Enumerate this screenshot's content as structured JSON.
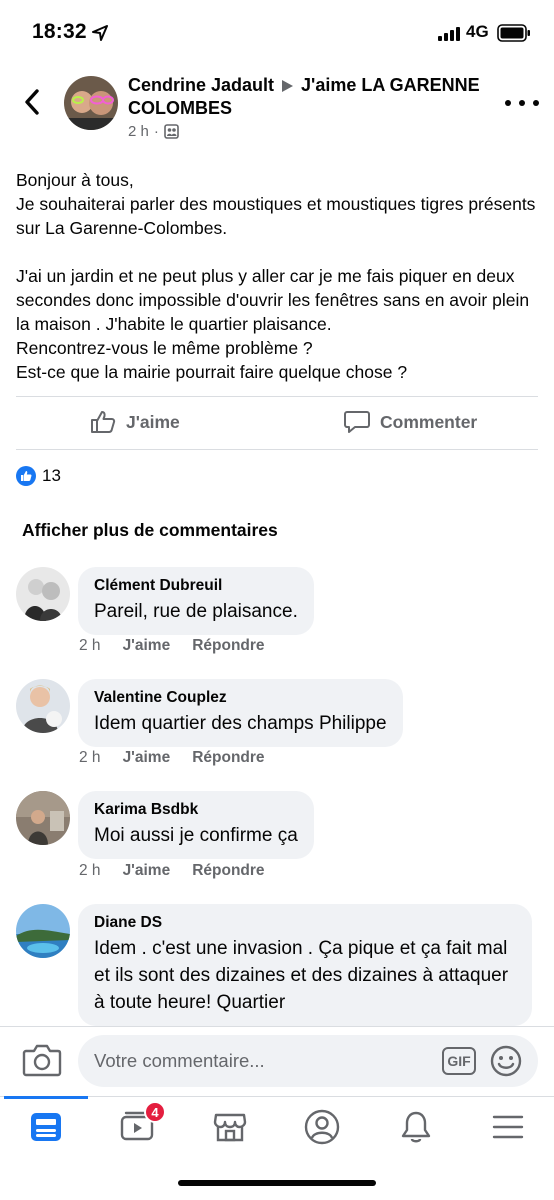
{
  "status_bar": {
    "time": "18:32",
    "network": "4G",
    "icons": [
      "location-arrow-icon",
      "signal-bars-icon",
      "battery-icon"
    ]
  },
  "post": {
    "author": "Cendrine Jadault",
    "group": "J'aime LA GARENNE COLOMBES",
    "time": "2 h",
    "separator": "·",
    "privacy_icon": "members-icon",
    "body_lines": [
      "Bonjour à tous,",
      "Je souhaiterai parler des moustiques et moustiques tigres présents sur La Garenne-Colombes.",
      "",
      "J'ai un jardin et ne peut plus y aller car je me fais piquer en deux secondes donc impossible d'ouvrir les fenêtres sans en avoir plein la maison . J'habite le quartier plaisance.",
      "Rencontrez-vous le même problème ?",
      "Est-ce que la mairie pourrait faire quelque chose ?"
    ]
  },
  "actions": {
    "like_label": "J'aime",
    "comment_label": "Commenter"
  },
  "reactions": {
    "count": "13",
    "icon": "like-reaction-icon"
  },
  "more_comments_label": "Afficher plus de commentaires",
  "comments": [
    {
      "name": "Clément Dubreuil",
      "text": "Pareil, rue de plaisance.",
      "time": "2 h",
      "like": "J'aime",
      "reply": "Répondre"
    },
    {
      "name": "Valentine Couplez",
      "text": "Idem quartier des champs Philippe",
      "time": "2 h",
      "like": "J'aime",
      "reply": "Répondre"
    },
    {
      "name": "Karima Bsdbk",
      "text": "Moi aussi je confirme ça",
      "time": "2 h",
      "like": "J'aime",
      "reply": "Répondre"
    },
    {
      "name": "Diane DS",
      "text": "Idem . c'est une invasion . Ça pique et ça fait mal et ils sont des dizaines et des dizaines à attaquer à toute heure! Quartier"
    }
  ],
  "composer": {
    "placeholder": "Votre commentaire...",
    "gif_label": "GIF"
  },
  "tab_bar": {
    "tabs": [
      "news-feed-icon",
      "watch-icon",
      "marketplace-icon",
      "profile-icon",
      "notifications-icon",
      "menu-icon"
    ],
    "watch_badge": "4"
  },
  "colors": {
    "accent": "#1877f2",
    "secondary_text": "#65676b",
    "bubble": "#f0f2f5",
    "badge": "#e41e3f"
  }
}
